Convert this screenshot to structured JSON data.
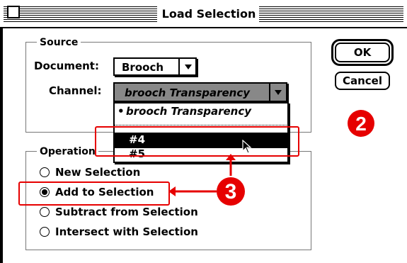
{
  "window": {
    "title": "Load Selection"
  },
  "source": {
    "group_label": "Source",
    "document_label": "Document:",
    "document_value": "Brooch",
    "channel_label": "Channel:",
    "channel_value": "brooch Transparency",
    "channel_menu": {
      "items": [
        {
          "label": "brooch Transparency",
          "checked": "•"
        },
        {
          "label": "#4"
        },
        {
          "label": "#5"
        }
      ]
    }
  },
  "buttons": {
    "ok": "OK",
    "cancel": "Cancel"
  },
  "operation": {
    "group_label": "Operation",
    "options": [
      {
        "label": "New Selection",
        "selected": false
      },
      {
        "label": "Add to Selection",
        "selected": true
      },
      {
        "label": "Subtract from Selection",
        "selected": false
      },
      {
        "label": "Intersect with Selection",
        "selected": false
      }
    ]
  },
  "annotations": {
    "badge_2": "2",
    "badge_3": "3"
  },
  "colors": {
    "annotation": "#e60000",
    "highlight": "#000000"
  }
}
